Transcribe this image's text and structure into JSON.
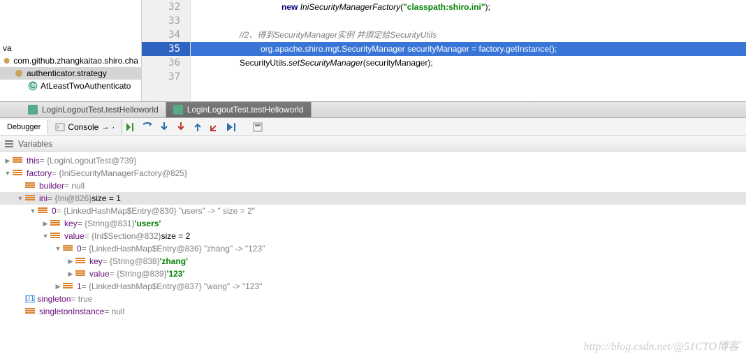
{
  "project": {
    "ext": "va",
    "pkg": "com.github.zhangkaitao.shiro.cha",
    "sub": "authenticator.strategy",
    "cls": "AtLeastTwoAuthenticato"
  },
  "editor": {
    "lines": {
      "l32": {
        "kw": "new",
        "cls": "IniSecurityManagerFactory",
        "str": "\"classpath:shiro.ini\"",
        "tail": ");"
      },
      "l34": "//2、得到SecurityManager实例 并绑定给SecurityUtils",
      "l35": "org.apache.shiro.mgt.SecurityManager securityManager = factory.getInstance();",
      "l36_a": "SecurityUtils.",
      "l36_b": "setSecurityManager",
      "l36_c": "(securityManager);"
    },
    "nums": [
      "32",
      "33",
      "34",
      "35",
      "36",
      "37"
    ]
  },
  "tabs": {
    "t1": "LoginLogoutTest.testHelloworld",
    "t2": "LoginLogoutTest.testHelloworld"
  },
  "tools": {
    "debugger": "Debugger",
    "console": "Console"
  },
  "varHeader": "Variables",
  "vars": {
    "this_n": "this",
    "this_v": " = {LoginLogoutTest@739}",
    "factory_n": "factory",
    "factory_v": " = {IniSecurityManagerFactory@825}",
    "builder_n": "builder",
    "builder_v": " = null",
    "ini_n": "ini",
    "ini_v": " = {Ini@826}",
    "ini_s": "  size = 1",
    "e0_n": "0",
    "e0_v": " = {LinkedHashMap$Entry@830} \"users\" -> \" size = 2\"",
    "k_n": "key",
    "k_v": " = {String@831} ",
    "k_lit": "'users'",
    "val_n": "value",
    "val_v": " = {Ini$Section@832}",
    "val_s": "  size = 2",
    "e00_n": "0",
    "e00_v": " = {LinkedHashMap$Entry@836} \"zhang\" -> \"123\"",
    "k2_n": "key",
    "k2_v": " = {String@838} ",
    "k2_lit": "'zhang'",
    "v2_n": "value",
    "v2_v": " = {String@839} ",
    "v2_lit": "'123'",
    "e01_n": "1",
    "e01_v": " = {LinkedHashMap$Entry@837} \"wang\" -> \"123\"",
    "sing_n": "singleton",
    "sing_v": " = true",
    "si_n": "singletonInstance",
    "si_v": " = null"
  },
  "watermark": "http://blog.csdn.net/@51CTO博客",
  "chart_data": {
    "type": "table",
    "title": "Debugger Variables — factory (IniSecurityManagerFactory@825)",
    "rows": [
      {
        "path": "this",
        "type": "LoginLogoutTest@739",
        "value": ""
      },
      {
        "path": "factory",
        "type": "IniSecurityManagerFactory@825",
        "value": ""
      },
      {
        "path": "factory.builder",
        "type": "",
        "value": "null"
      },
      {
        "path": "factory.ini",
        "type": "Ini@826",
        "value": "size = 1"
      },
      {
        "path": "factory.ini[0]",
        "type": "LinkedHashMap$Entry@830",
        "value": "\"users\" -> \" size = 2\""
      },
      {
        "path": "factory.ini[0].key",
        "type": "String@831",
        "value": "users"
      },
      {
        "path": "factory.ini[0].value",
        "type": "Ini$Section@832",
        "value": "size = 2"
      },
      {
        "path": "factory.ini[0].value[0]",
        "type": "LinkedHashMap$Entry@836",
        "value": "\"zhang\" -> \"123\""
      },
      {
        "path": "factory.ini[0].value[0].key",
        "type": "String@838",
        "value": "zhang"
      },
      {
        "path": "factory.ini[0].value[0].value",
        "type": "String@839",
        "value": "123"
      },
      {
        "path": "factory.ini[0].value[1]",
        "type": "LinkedHashMap$Entry@837",
        "value": "\"wang\" -> \"123\""
      },
      {
        "path": "factory.singleton",
        "type": "",
        "value": "true"
      },
      {
        "path": "factory.singletonInstance",
        "type": "",
        "value": "null"
      }
    ]
  }
}
